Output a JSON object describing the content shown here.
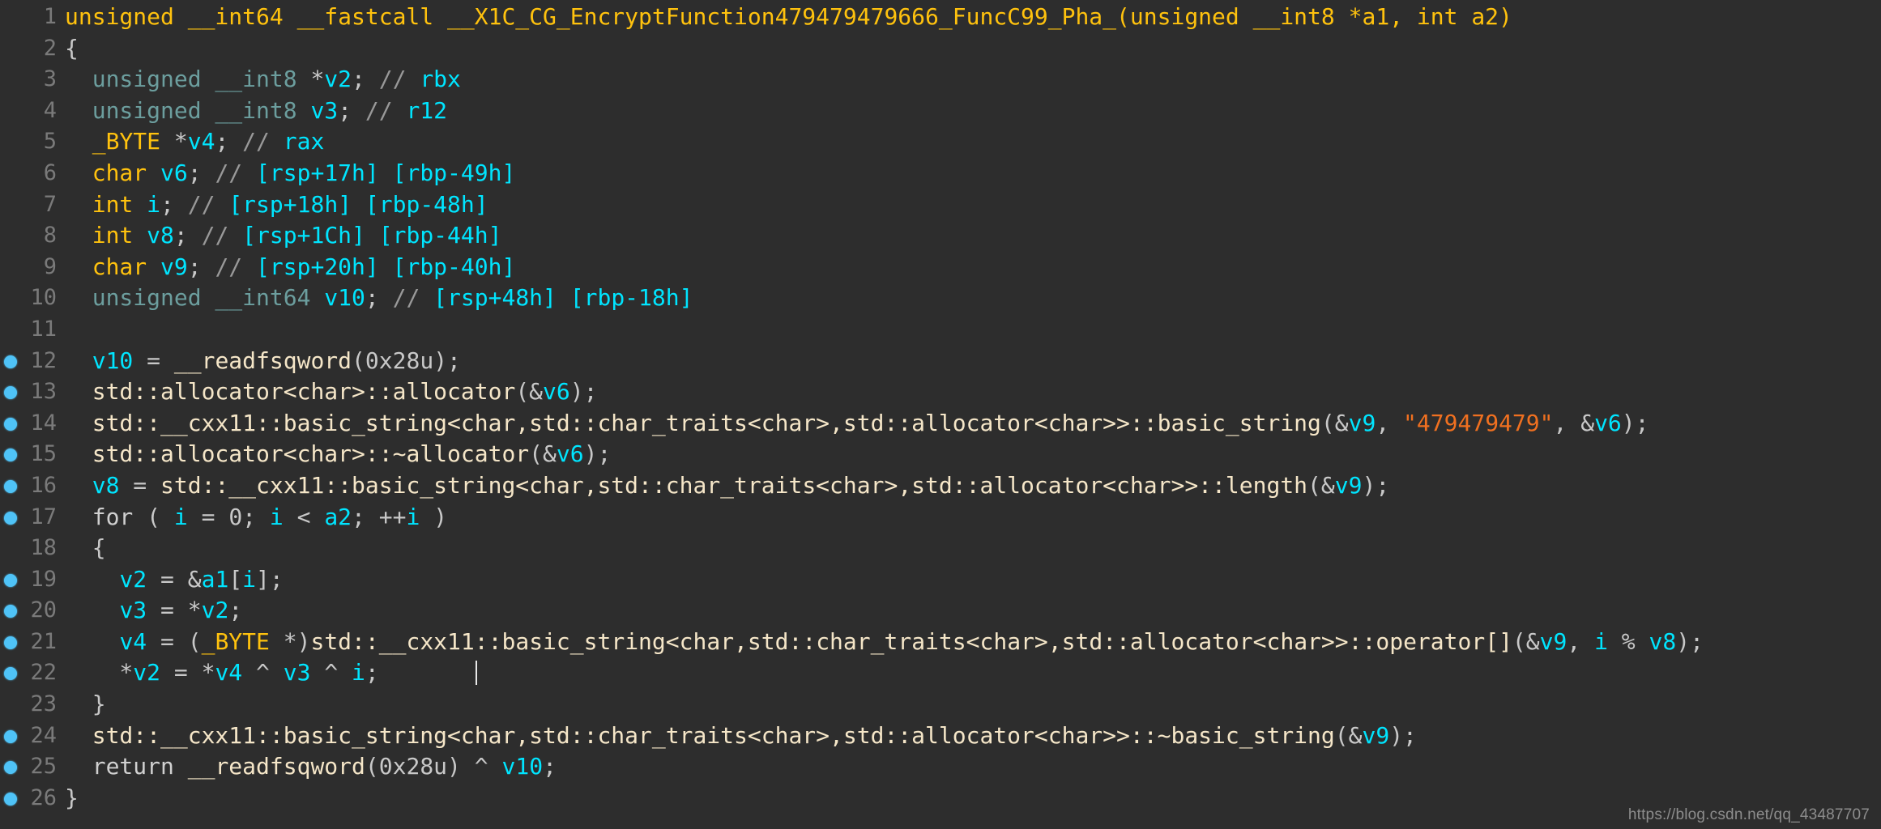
{
  "app": {
    "view": "pseudocode",
    "background_color": "#2d2d2d",
    "breakpoint_color": "#4fc3f7",
    "watermark": "https://blog.csdn.net/qq_43487707"
  },
  "palette": {
    "function_name": "#ffc20e",
    "type_keyword": "#ffc20e",
    "unsigned_type": "#6c9e9e",
    "variable": "#00e5ff",
    "comment": "#999999",
    "register": "#00e5ff",
    "library_call": "#f5e6c8",
    "punctuation": "#c8c8c8",
    "string_literal": "#f07020",
    "line_number": "#7a7a7a"
  },
  "lines": [
    {
      "number": "1",
      "breakpoint": false,
      "tokens": [
        {
          "text": "unsigned __int64 __fastcall __X1C_CG_EncryptFunction479479479666_FuncC99_Pha_",
          "cls": "t-func"
        },
        {
          "text": "(",
          "cls": "t-func"
        },
        {
          "text": "unsigned __int8 *a1, int a2",
          "cls": "t-func"
        },
        {
          "text": ")",
          "cls": "t-func"
        }
      ]
    },
    {
      "number": "2",
      "breakpoint": false,
      "tokens": [
        {
          "text": "{",
          "cls": "t-brace"
        }
      ]
    },
    {
      "number": "3",
      "breakpoint": false,
      "tokens": [
        {
          "text": "  ",
          "cls": "t-plain"
        },
        {
          "text": "unsigned __int8 ",
          "cls": "t-tealty"
        },
        {
          "text": "*",
          "cls": "t-plain"
        },
        {
          "text": "v2",
          "cls": "t-var"
        },
        {
          "text": "; ",
          "cls": "t-plain"
        },
        {
          "text": "// ",
          "cls": "t-com"
        },
        {
          "text": "rbx",
          "cls": "t-reg"
        }
      ]
    },
    {
      "number": "4",
      "breakpoint": false,
      "tokens": [
        {
          "text": "  ",
          "cls": "t-plain"
        },
        {
          "text": "unsigned __int8 ",
          "cls": "t-tealty"
        },
        {
          "text": "v3",
          "cls": "t-var"
        },
        {
          "text": "; ",
          "cls": "t-plain"
        },
        {
          "text": "// ",
          "cls": "t-com"
        },
        {
          "text": "r12",
          "cls": "t-reg"
        }
      ]
    },
    {
      "number": "5",
      "breakpoint": false,
      "tokens": [
        {
          "text": "  ",
          "cls": "t-plain"
        },
        {
          "text": "_BYTE ",
          "cls": "t-type"
        },
        {
          "text": "*",
          "cls": "t-plain"
        },
        {
          "text": "v4",
          "cls": "t-var"
        },
        {
          "text": "; ",
          "cls": "t-plain"
        },
        {
          "text": "// ",
          "cls": "t-com"
        },
        {
          "text": "rax",
          "cls": "t-reg"
        }
      ]
    },
    {
      "number": "6",
      "breakpoint": false,
      "tokens": [
        {
          "text": "  ",
          "cls": "t-plain"
        },
        {
          "text": "char ",
          "cls": "t-type"
        },
        {
          "text": "v6",
          "cls": "t-var"
        },
        {
          "text": "; ",
          "cls": "t-plain"
        },
        {
          "text": "// ",
          "cls": "t-com"
        },
        {
          "text": "[rsp+17h] [rbp-49h]",
          "cls": "t-reg"
        }
      ]
    },
    {
      "number": "7",
      "breakpoint": false,
      "tokens": [
        {
          "text": "  ",
          "cls": "t-plain"
        },
        {
          "text": "int ",
          "cls": "t-type"
        },
        {
          "text": "i",
          "cls": "t-var"
        },
        {
          "text": "; ",
          "cls": "t-plain"
        },
        {
          "text": "// ",
          "cls": "t-com"
        },
        {
          "text": "[rsp+18h] [rbp-48h]",
          "cls": "t-reg"
        }
      ]
    },
    {
      "number": "8",
      "breakpoint": false,
      "tokens": [
        {
          "text": "  ",
          "cls": "t-plain"
        },
        {
          "text": "int ",
          "cls": "t-type"
        },
        {
          "text": "v8",
          "cls": "t-var"
        },
        {
          "text": "; ",
          "cls": "t-plain"
        },
        {
          "text": "// ",
          "cls": "t-com"
        },
        {
          "text": "[rsp+1Ch] [rbp-44h]",
          "cls": "t-reg"
        }
      ]
    },
    {
      "number": "9",
      "breakpoint": false,
      "tokens": [
        {
          "text": "  ",
          "cls": "t-plain"
        },
        {
          "text": "char ",
          "cls": "t-type"
        },
        {
          "text": "v9",
          "cls": "t-var"
        },
        {
          "text": "; ",
          "cls": "t-plain"
        },
        {
          "text": "// ",
          "cls": "t-com"
        },
        {
          "text": "[rsp+20h] [rbp-40h]",
          "cls": "t-reg"
        }
      ]
    },
    {
      "number": "10",
      "breakpoint": false,
      "tokens": [
        {
          "text": "  ",
          "cls": "t-plain"
        },
        {
          "text": "unsigned __int64 ",
          "cls": "t-tealty"
        },
        {
          "text": "v10",
          "cls": "t-var"
        },
        {
          "text": "; ",
          "cls": "t-plain"
        },
        {
          "text": "// ",
          "cls": "t-com"
        },
        {
          "text": "[rsp+48h] [rbp-18h]",
          "cls": "t-reg"
        }
      ]
    },
    {
      "number": "11",
      "breakpoint": false,
      "tokens": [
        {
          "text": "",
          "cls": "t-plain"
        }
      ]
    },
    {
      "number": "12",
      "breakpoint": true,
      "tokens": [
        {
          "text": "  ",
          "cls": "t-plain"
        },
        {
          "text": "v10",
          "cls": "t-var"
        },
        {
          "text": " = ",
          "cls": "t-plain"
        },
        {
          "text": "__readfsqword",
          "cls": "t-call"
        },
        {
          "text": "(",
          "cls": "t-plain"
        },
        {
          "text": "0x28u",
          "cls": "t-num"
        },
        {
          "text": ");",
          "cls": "t-plain"
        }
      ]
    },
    {
      "number": "13",
      "breakpoint": true,
      "tokens": [
        {
          "text": "  ",
          "cls": "t-plain"
        },
        {
          "text": "std::allocator<char>::allocator",
          "cls": "t-call"
        },
        {
          "text": "(&",
          "cls": "t-plain"
        },
        {
          "text": "v6",
          "cls": "t-var"
        },
        {
          "text": ");",
          "cls": "t-plain"
        }
      ]
    },
    {
      "number": "14",
      "breakpoint": true,
      "tokens": [
        {
          "text": "  ",
          "cls": "t-plain"
        },
        {
          "text": "std::__cxx11::basic_string<char,std::char_traits<char>,std::allocator<char>>::basic_string",
          "cls": "t-call"
        },
        {
          "text": "(&",
          "cls": "t-plain"
        },
        {
          "text": "v9",
          "cls": "t-var"
        },
        {
          "text": ", ",
          "cls": "t-plain"
        },
        {
          "text": "\"479479479\"",
          "cls": "t-str"
        },
        {
          "text": ", &",
          "cls": "t-plain"
        },
        {
          "text": "v6",
          "cls": "t-var"
        },
        {
          "text": ");",
          "cls": "t-plain"
        }
      ]
    },
    {
      "number": "15",
      "breakpoint": true,
      "tokens": [
        {
          "text": "  ",
          "cls": "t-plain"
        },
        {
          "text": "std::allocator<char>::~allocator",
          "cls": "t-call"
        },
        {
          "text": "(&",
          "cls": "t-plain"
        },
        {
          "text": "v6",
          "cls": "t-var"
        },
        {
          "text": ");",
          "cls": "t-plain"
        }
      ]
    },
    {
      "number": "16",
      "breakpoint": true,
      "tokens": [
        {
          "text": "  ",
          "cls": "t-plain"
        },
        {
          "text": "v8",
          "cls": "t-var"
        },
        {
          "text": " = ",
          "cls": "t-plain"
        },
        {
          "text": "std::__cxx11::basic_string<char,std::char_traits<char>,std::allocator<char>>::length",
          "cls": "t-call"
        },
        {
          "text": "(&",
          "cls": "t-plain"
        },
        {
          "text": "v9",
          "cls": "t-var"
        },
        {
          "text": ");",
          "cls": "t-plain"
        }
      ]
    },
    {
      "number": "17",
      "breakpoint": true,
      "tokens": [
        {
          "text": "  ",
          "cls": "t-plain"
        },
        {
          "text": "for",
          "cls": "t-kw"
        },
        {
          "text": " ( ",
          "cls": "t-plain"
        },
        {
          "text": "i",
          "cls": "t-var"
        },
        {
          "text": " = ",
          "cls": "t-plain"
        },
        {
          "text": "0",
          "cls": "t-num"
        },
        {
          "text": "; ",
          "cls": "t-plain"
        },
        {
          "text": "i",
          "cls": "t-var"
        },
        {
          "text": " < ",
          "cls": "t-plain"
        },
        {
          "text": "a2",
          "cls": "t-var"
        },
        {
          "text": "; ++",
          "cls": "t-plain"
        },
        {
          "text": "i",
          "cls": "t-var"
        },
        {
          "text": " )",
          "cls": "t-plain"
        }
      ]
    },
    {
      "number": "18",
      "breakpoint": false,
      "tokens": [
        {
          "text": "  ",
          "cls": "t-plain"
        },
        {
          "text": "{",
          "cls": "t-brace"
        }
      ]
    },
    {
      "number": "19",
      "breakpoint": true,
      "tokens": [
        {
          "text": "    ",
          "cls": "t-plain"
        },
        {
          "text": "v2",
          "cls": "t-var"
        },
        {
          "text": " = &",
          "cls": "t-plain"
        },
        {
          "text": "a1",
          "cls": "t-var"
        },
        {
          "text": "[",
          "cls": "t-plain"
        },
        {
          "text": "i",
          "cls": "t-var"
        },
        {
          "text": "];",
          "cls": "t-plain"
        }
      ]
    },
    {
      "number": "20",
      "breakpoint": true,
      "tokens": [
        {
          "text": "    ",
          "cls": "t-plain"
        },
        {
          "text": "v3",
          "cls": "t-var"
        },
        {
          "text": " = *",
          "cls": "t-plain"
        },
        {
          "text": "v2",
          "cls": "t-var"
        },
        {
          "text": ";",
          "cls": "t-plain"
        }
      ]
    },
    {
      "number": "21",
      "breakpoint": true,
      "tokens": [
        {
          "text": "    ",
          "cls": "t-plain"
        },
        {
          "text": "v4",
          "cls": "t-var"
        },
        {
          "text": " = (",
          "cls": "t-plain"
        },
        {
          "text": "_BYTE ",
          "cls": "t-type"
        },
        {
          "text": "*)",
          "cls": "t-plain"
        },
        {
          "text": "std::__cxx11::basic_string<char,std::char_traits<char>,std::allocator<char>>::operator[]",
          "cls": "t-call"
        },
        {
          "text": "(&",
          "cls": "t-plain"
        },
        {
          "text": "v9",
          "cls": "t-var"
        },
        {
          "text": ", ",
          "cls": "t-plain"
        },
        {
          "text": "i",
          "cls": "t-var"
        },
        {
          "text": " % ",
          "cls": "t-plain"
        },
        {
          "text": "v8",
          "cls": "t-var"
        },
        {
          "text": ");",
          "cls": "t-plain"
        }
      ]
    },
    {
      "number": "22",
      "breakpoint": true,
      "caret": true,
      "tokens": [
        {
          "text": "    *",
          "cls": "t-plain"
        },
        {
          "text": "v2",
          "cls": "t-var"
        },
        {
          "text": " = *",
          "cls": "t-plain"
        },
        {
          "text": "v4",
          "cls": "t-var"
        },
        {
          "text": " ^ ",
          "cls": "t-plain"
        },
        {
          "text": "v3",
          "cls": "t-var"
        },
        {
          "text": " ^ ",
          "cls": "t-plain"
        },
        {
          "text": "i",
          "cls": "t-var"
        },
        {
          "text": ";",
          "cls": "t-plain"
        }
      ]
    },
    {
      "number": "23",
      "breakpoint": false,
      "tokens": [
        {
          "text": "  ",
          "cls": "t-plain"
        },
        {
          "text": "}",
          "cls": "t-brace"
        }
      ]
    },
    {
      "number": "24",
      "breakpoint": true,
      "tokens": [
        {
          "text": "  ",
          "cls": "t-plain"
        },
        {
          "text": "std::__cxx11::basic_string<char,std::char_traits<char>,std::allocator<char>>::~basic_string",
          "cls": "t-call"
        },
        {
          "text": "(&",
          "cls": "t-plain"
        },
        {
          "text": "v9",
          "cls": "t-var"
        },
        {
          "text": ");",
          "cls": "t-plain"
        }
      ]
    },
    {
      "number": "25",
      "breakpoint": true,
      "tokens": [
        {
          "text": "  ",
          "cls": "t-plain"
        },
        {
          "text": "return",
          "cls": "t-kw"
        },
        {
          "text": " ",
          "cls": "t-plain"
        },
        {
          "text": "__readfsqword",
          "cls": "t-call"
        },
        {
          "text": "(",
          "cls": "t-plain"
        },
        {
          "text": "0x28u",
          "cls": "t-num"
        },
        {
          "text": ") ^ ",
          "cls": "t-plain"
        },
        {
          "text": "v10",
          "cls": "t-var"
        },
        {
          "text": ";",
          "cls": "t-plain"
        }
      ]
    },
    {
      "number": "26",
      "breakpoint": true,
      "tokens": [
        {
          "text": "}",
          "cls": "t-brace"
        }
      ]
    }
  ]
}
